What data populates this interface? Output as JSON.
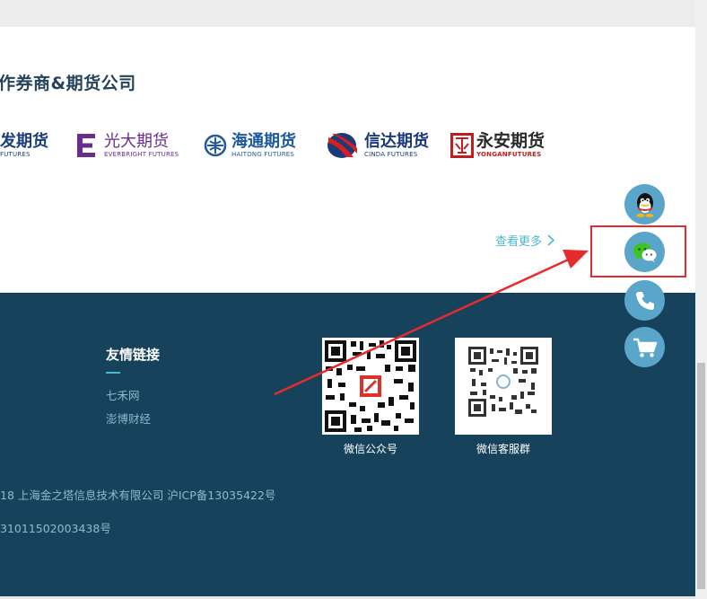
{
  "partners": {
    "title": "作券商&期货公司",
    "logos": [
      {
        "cn": "发期货",
        "en": "FUTURES"
      },
      {
        "cn": "光大期货",
        "en": "EVERBRIGHT FUTURES"
      },
      {
        "cn": "海通期货",
        "en": "HAITONG FUTURES"
      },
      {
        "cn": "信达期货",
        "en": "CINDA FUTURES"
      },
      {
        "cn": "永安期货",
        "en": "YONGANFUTURES"
      }
    ],
    "more_label": "查看更多"
  },
  "footer": {
    "links_title": "友情链接",
    "links": [
      "七禾网",
      "澎博财经"
    ],
    "qr": [
      {
        "caption": "微信公众号"
      },
      {
        "caption": "微信客服群"
      }
    ],
    "copyright": "18 上海金之塔信息技术有限公司    沪ICP备13035422号",
    "police_record": "31011502003438号"
  },
  "float_bar": {
    "buttons": [
      {
        "icon": "qq-icon"
      },
      {
        "icon": "wechat-icon"
      },
      {
        "icon": "phone-icon"
      },
      {
        "icon": "cart-icon"
      }
    ]
  },
  "colors": {
    "footer_bg": "#17425c",
    "accent": "#4fb7cf",
    "float_btn": "#5aa6cb",
    "highlight": "#e52b2b"
  }
}
